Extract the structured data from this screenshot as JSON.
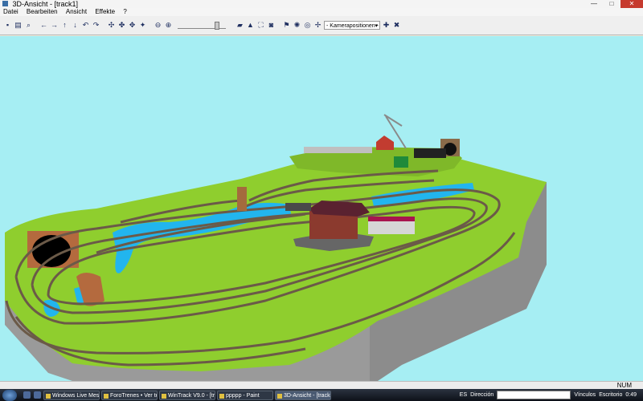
{
  "window": {
    "title": "3D-Ansicht - [track1]"
  },
  "menu": {
    "items": [
      "Datei",
      "Bearbeiten",
      "Ansicht",
      "Effekte",
      "?"
    ]
  },
  "toolbar": {
    "camera_positions": "- Kamerapositionen -"
  },
  "status": {
    "num": "NUM"
  },
  "taskbar": {
    "tasks": [
      "Windows Live Mess...",
      "ForoTrenes • Ver te...",
      "WinTrack V9.0 - [tra...",
      "ppppp - Paint",
      "3D-Ansicht - [track1]"
    ],
    "lang": "ES",
    "direccion": "Dirección",
    "vinculos": "Vínculos",
    "escritorio": "Escritorio",
    "clock": "0:49"
  },
  "colors": {
    "sky": "#a6eef3",
    "grass": "#8fce2e",
    "water": "#22b5ee",
    "cliff": "#8d8d8d"
  }
}
